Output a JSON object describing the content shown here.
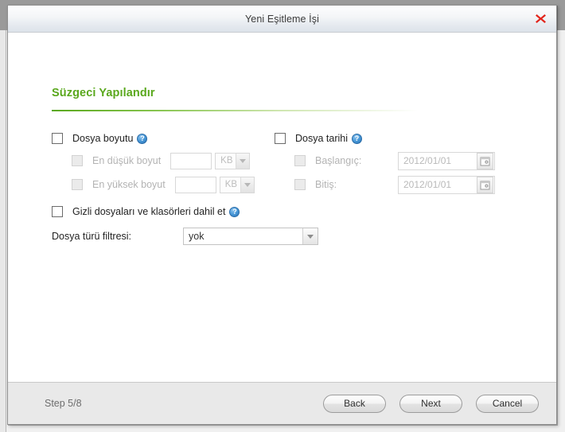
{
  "window": {
    "title": "Yeni Eşitleme İşi",
    "close_icon": "close-x-icon"
  },
  "section": {
    "title": "Süzgeci Yapılandır"
  },
  "file_size": {
    "label": "Dosya boyutu",
    "checked": false,
    "help_icon": "help-question-icon",
    "help_glyph": "?",
    "min": {
      "label": "En düşük boyut",
      "checked": false,
      "value": "",
      "unit": "KB"
    },
    "max": {
      "label": "En yüksek boyut",
      "checked": false,
      "value": "",
      "unit": "KB"
    }
  },
  "file_date": {
    "label": "Dosya tarihi",
    "checked": false,
    "help_icon": "help-question-icon",
    "help_glyph": "?",
    "start": {
      "label": "Başlangıç:",
      "checked": false,
      "value": "2012/01/01",
      "calendar_icon": "calendar-icon"
    },
    "end": {
      "label": "Bitiş:",
      "checked": false,
      "value": "2012/01/01",
      "calendar_icon": "calendar-icon"
    }
  },
  "hidden_files": {
    "label": "Gizli dosyaları ve klasörleri dahil et",
    "checked": false,
    "help_icon": "help-question-icon",
    "help_glyph": "?"
  },
  "type_filter": {
    "label": "Dosya türü filtresi:",
    "value": "yok",
    "options": [
      "yok"
    ]
  },
  "footer": {
    "step": "Step 5/8",
    "back": "Back",
    "next": "Next",
    "cancel": "Cancel"
  },
  "colors": {
    "accent_green": "#5aa81d",
    "close_red": "#e2231a",
    "help_blue": "#4a9ad9"
  }
}
